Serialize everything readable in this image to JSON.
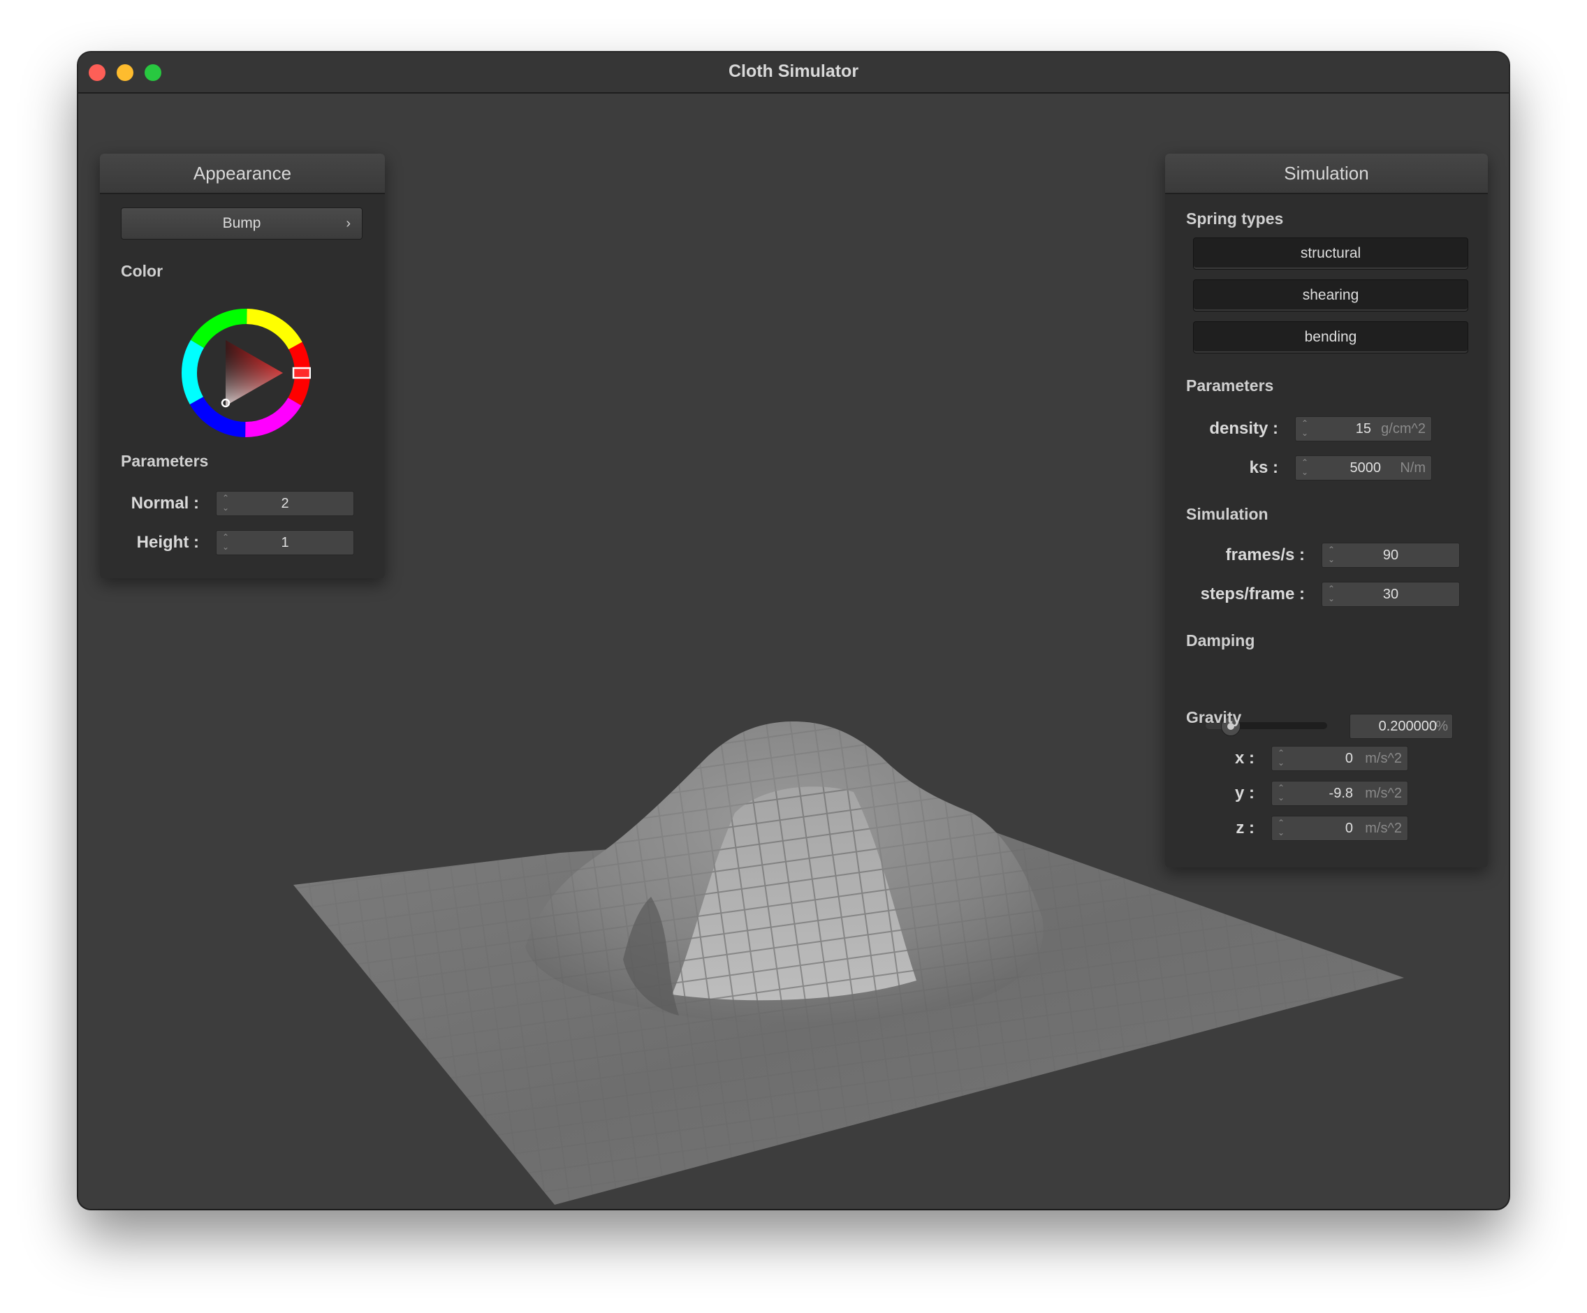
{
  "window": {
    "title": "Cloth Simulator"
  },
  "appearance": {
    "header": "Appearance",
    "shader_select": "Bump",
    "color_label": "Color",
    "color": {
      "hue": "#ff0000",
      "selected": "#8a2020"
    },
    "parameters_label": "Parameters",
    "normal_label": "Normal :",
    "normal_value": "2",
    "height_label": "Height :",
    "height_value": "1"
  },
  "simulation": {
    "header": "Simulation",
    "spring_types_label": "Spring types",
    "spring_buttons": [
      "structural",
      "shearing",
      "bending"
    ],
    "parameters_label": "Parameters",
    "density_label": "density :",
    "density_value": "15",
    "density_unit": "g/cm^2",
    "ks_label": "ks :",
    "ks_value": "5000",
    "ks_unit": "N/m",
    "simulation_label": "Simulation",
    "fps_label": "frames/s :",
    "fps_value": "90",
    "steps_label": "steps/frame :",
    "steps_value": "30",
    "damping_label": "Damping",
    "damping_value": "0.200000",
    "damping_unit": "%",
    "damping_slider_fraction": 0.2,
    "gravity_label": "Gravity",
    "gx_label": "x :",
    "gx_value": "0",
    "gy_label": "y :",
    "gy_value": "-9.8",
    "gz_label": "z :",
    "gz_value": "0",
    "gravity_unit": "m/s^2"
  }
}
